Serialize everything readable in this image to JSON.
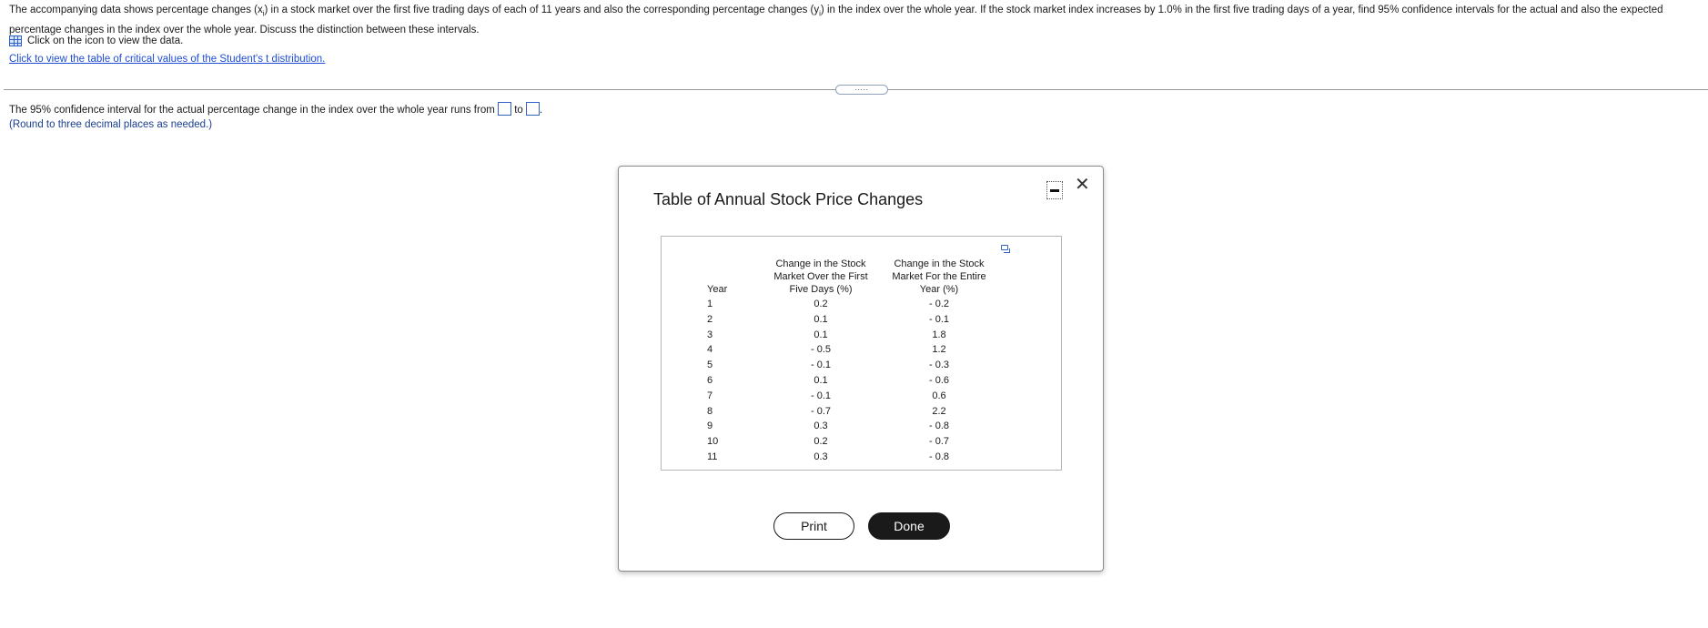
{
  "question": {
    "intro": "The accompanying data shows percentage changes (x",
    "sub_i": "i",
    "mid": ") in a stock market over the first five trading days of each of 11 years and also the corresponding percentage changes (y",
    "sub_i2": "i",
    "rest": ") in the index over the whole year. If the stock market index increases by 1.0% in the first five trading days of a year, find 95% confidence intervals for the actual and also the expected percentage changes in the index over the whole year. Discuss the distinction between these intervals.",
    "data_link_text": "Click on the icon to view the data.",
    "t_table_link": "Click to view the table of critical values of the Student's t distribution."
  },
  "divider": {
    "more_label": "....."
  },
  "answer": {
    "text_before": "The 95% confidence interval for the actual percentage change in the index over the whole year runs from",
    "text_to": "to",
    "text_end": ".",
    "round_note": "(Round to three decimal places as needed.)"
  },
  "modal": {
    "title": "Table of Annual Stock Price Changes",
    "columns": {
      "year": "Year",
      "first_five": [
        "Change in the Stock",
        "Market Over the First",
        "Five Days (%)"
      ],
      "entire_year": [
        "Change in the Stock",
        "Market For the Entire",
        "Year (%)"
      ]
    },
    "rows": [
      {
        "year": "1",
        "first": "0.2",
        "whole": "- 0.2"
      },
      {
        "year": "2",
        "first": "0.1",
        "whole": "- 0.1"
      },
      {
        "year": "3",
        "first": "0.1",
        "whole": "1.8"
      },
      {
        "year": "4",
        "first": "- 0.5",
        "whole": "1.2"
      },
      {
        "year": "5",
        "first": "- 0.1",
        "whole": "- 0.3"
      },
      {
        "year": "6",
        "first": "0.1",
        "whole": "- 0.6"
      },
      {
        "year": "7",
        "first": "- 0.1",
        "whole": "0.6"
      },
      {
        "year": "8",
        "first": "- 0.7",
        "whole": "2.2"
      },
      {
        "year": "9",
        "first": "0.3",
        "whole": "- 0.8"
      },
      {
        "year": "10",
        "first": "0.2",
        "whole": "- 0.7"
      },
      {
        "year": "11",
        "first": "0.3",
        "whole": "- 0.8"
      }
    ],
    "print_label": "Print",
    "done_label": "Done",
    "close_icon": "close-icon",
    "minimize_icon": "minimize-icon"
  },
  "colors": {
    "link": "#1f4dd6",
    "accent": "#2f62c4",
    "done_bg": "#1a1a1a"
  }
}
